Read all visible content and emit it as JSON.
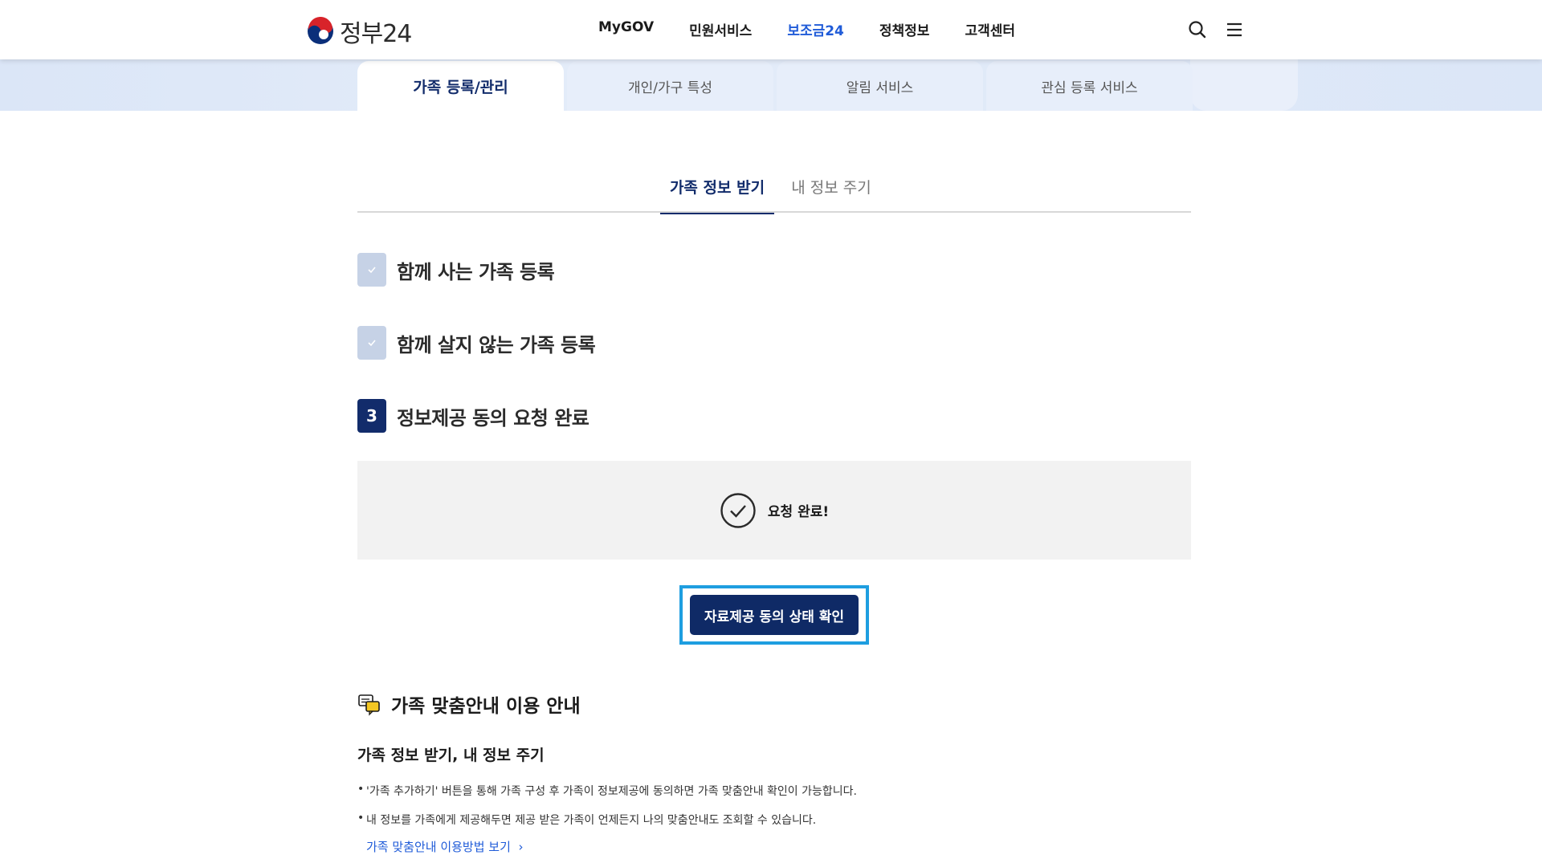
{
  "header": {
    "logo_text": "정부24",
    "nav": [
      "MyGOV",
      "민원서비스",
      "보조금24",
      "정책정보",
      "고객센터"
    ],
    "active_nav_index": 2,
    "icons": [
      "search-icon",
      "menu-icon"
    ]
  },
  "top_tabs": [
    "가족 등록/관리",
    "개인/가구 특성",
    "알림 서비스",
    "관심 등록 서비스"
  ],
  "sub_tabs": [
    "가족 정보 받기",
    "내 정보 주기"
  ],
  "steps": [
    {
      "label": "함께 사는 가족 등록",
      "state": "done"
    },
    {
      "label": "함께 살지 않는 가족 등록",
      "state": "done"
    },
    {
      "number": "3",
      "label": "정보제공 동의 요청 완료",
      "state": "current"
    }
  ],
  "result": {
    "text": "요청 완료!"
  },
  "primary_button": {
    "label": "자료제공 동의 상태 확인"
  },
  "guide": {
    "title": "가족 맞춤안내 이용 안내",
    "subtitle": "가족 정보 받기, 내 정보 주기",
    "bullets": [
      "'가족 추가하기' 버튼을 통해 가족 구성 후 가족이 정보제공에 동의하면 가족 맞춤안내 확인이 가능합니다.",
      "내 정보를 가족에게 제공해두면 제공 받은 가족이 언제든지 나의 맞춤안내도 조회할 수 있습니다."
    ],
    "link": "가족 맞춤안내 이용방법 보기"
  },
  "colors": {
    "primary": "#0f2a66",
    "accent_blue": "#1f5bd8",
    "highlight_frame": "#1e9ee0"
  }
}
